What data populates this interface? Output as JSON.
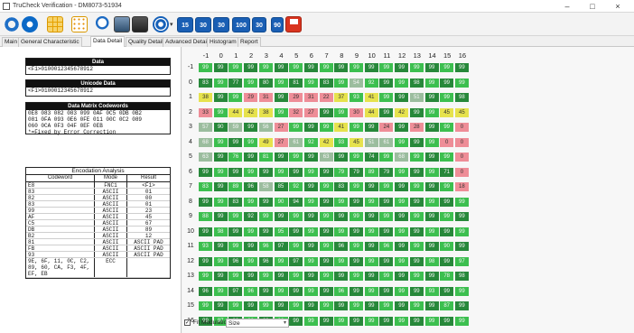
{
  "window": {
    "title": "TruCheck Verification - DM8073-51934"
  },
  "toolbar": {
    "buttons": [
      {
        "icon": "gear-refresh-icon"
      },
      {
        "icon": "refresh-icon"
      },
      {
        "icon": "module-grid-icon"
      },
      {
        "icon": "dotted-grid-icon"
      },
      {
        "icon": "zoom-icon"
      },
      {
        "icon": "image-icon"
      },
      {
        "icon": "image-dark-icon"
      },
      {
        "icon": "target-icon"
      }
    ],
    "level_buttons": [
      "15",
      "30",
      "30",
      "100",
      "30",
      "90"
    ]
  },
  "tabs": [
    "Main",
    "General Characteristic",
    "Data Detail",
    "Quality Detail",
    "Advanced Detail",
    "Histogram",
    "Report"
  ],
  "active_tab": "Data Detail",
  "data_panel": {
    "data": {
      "title": "Data",
      "value": "<F1>0100012345678912"
    },
    "unicode": {
      "title": "Unicode Data",
      "value": "<F1>0100012345678912"
    },
    "codewords": {
      "title": "Data Matrix Codewords",
      "lines": [
        "0E8 083 082 083 099 0AF 0C5 0DB 0B2",
        "081 0FA 093 0E6 0FE 011 00C 0C2 089",
        "060 0CA 0F3 04F 0EF 0EB",
        "*=Fixed by Error Correction"
      ]
    }
  },
  "encodation": {
    "title": "Encodation Analysis",
    "headers": [
      "Codeword",
      "Mode",
      "Result"
    ],
    "rows": [
      {
        "codeword": "E8",
        "mode": "FNC1",
        "result": "<F1>"
      },
      {
        "codeword": "83",
        "mode": "ASCII",
        "result": "01"
      },
      {
        "codeword": "82",
        "mode": "ASCII",
        "result": "00"
      },
      {
        "codeword": "83",
        "mode": "ASCII",
        "result": "01"
      },
      {
        "codeword": "99",
        "mode": "ASCII",
        "result": "23"
      },
      {
        "codeword": "AF",
        "mode": "ASCII",
        "result": "45"
      },
      {
        "codeword": "C5",
        "mode": "ASCII",
        "result": "67"
      },
      {
        "codeword": "DB",
        "mode": "ASCII",
        "result": "89"
      },
      {
        "codeword": "B2",
        "mode": "ASCII",
        "result": "12"
      },
      {
        "codeword": "81",
        "mode": "ASCII",
        "result": "ASCII PAD"
      },
      {
        "codeword": "FB",
        "mode": "ASCII",
        "result": "ASCII PAD"
      },
      {
        "codeword": "93",
        "mode": "ASCII",
        "result": "ASCII PAD"
      },
      {
        "codeword": "9E, 6F, 11, 0C, C2, 89, 60, CA, F3, 4F, EF, EB",
        "mode": "ECC",
        "result": ""
      }
    ]
  },
  "modulation_grid": {
    "columns": [
      "-1",
      "0",
      "1",
      "2",
      "3",
      "4",
      "5",
      "6",
      "7",
      "8",
      "9",
      "10",
      "11",
      "12",
      "13",
      "14",
      "15",
      "16"
    ],
    "rows": [
      "-1",
      "0",
      "1",
      "2",
      "3",
      "4",
      "5",
      "6",
      "7",
      "8",
      "9",
      "10",
      "11",
      "12",
      "13",
      "14",
      "15",
      "16"
    ],
    "values": [
      [
        "99",
        "99",
        "99",
        "99",
        "99",
        "99",
        "99",
        "99",
        "99",
        "99",
        "99",
        "99",
        "99",
        "99",
        "99",
        "99",
        "99",
        "99"
      ],
      [
        "83",
        "99",
        "77",
        "99",
        "80",
        "99",
        "81",
        "99",
        "83",
        "99",
        "54",
        "92",
        "99",
        "99",
        "98",
        "99",
        "99",
        "99"
      ],
      [
        "38",
        "99",
        "99",
        "29",
        "31",
        "99",
        "29",
        "31",
        "22",
        "37",
        "93",
        "41",
        "99",
        "99",
        "51",
        "99",
        "99",
        "98"
      ],
      [
        "33",
        "99",
        "44",
        "42",
        "38",
        "99",
        "32",
        "27",
        "99",
        "99",
        "30",
        "44",
        "99",
        "42",
        "99",
        "99",
        "45",
        "45"
      ],
      [
        "57",
        "90",
        "59",
        "99",
        "56",
        "27",
        "99",
        "99",
        "99",
        "41",
        "99",
        "99",
        "24",
        "99",
        "28",
        "99",
        "99",
        "0"
      ],
      [
        "68",
        "99",
        "99",
        "99",
        "49",
        "27",
        "61",
        "92",
        "42",
        "93",
        "45",
        "51",
        "61",
        "99",
        "99",
        "99",
        "0",
        "0"
      ],
      [
        "63",
        "99",
        "76",
        "99",
        "81",
        "99",
        "99",
        "99",
        "63",
        "99",
        "99",
        "74",
        "99",
        "68",
        "99",
        "99",
        "99",
        "0"
      ],
      [
        "99",
        "99",
        "99",
        "99",
        "99",
        "99",
        "99",
        "99",
        "99",
        "79",
        "79",
        "89",
        "79",
        "99",
        "99",
        "99",
        "71",
        "0"
      ],
      [
        "83",
        "99",
        "89",
        "96",
        "58",
        "85",
        "92",
        "99",
        "99",
        "83",
        "99",
        "99",
        "99",
        "99",
        "99",
        "99",
        "99",
        "18"
      ],
      [
        "99",
        "99",
        "83",
        "99",
        "99",
        "90",
        "94",
        "99",
        "99",
        "99",
        "99",
        "99",
        "99",
        "99",
        "99",
        "99",
        "99",
        "99"
      ],
      [
        "88",
        "99",
        "99",
        "92",
        "99",
        "99",
        "99",
        "99",
        "99",
        "99",
        "99",
        "99",
        "99",
        "99",
        "99",
        "99",
        "99",
        "99"
      ],
      [
        "99",
        "98",
        "99",
        "99",
        "99",
        "95",
        "99",
        "99",
        "99",
        "99",
        "99",
        "99",
        "99",
        "99",
        "99",
        "99",
        "99",
        "99"
      ],
      [
        "93",
        "99",
        "99",
        "99",
        "96",
        "97",
        "99",
        "99",
        "99",
        "96",
        "99",
        "99",
        "96",
        "99",
        "99",
        "99",
        "90",
        "99"
      ],
      [
        "99",
        "99",
        "96",
        "99",
        "96",
        "99",
        "97",
        "99",
        "99",
        "99",
        "99",
        "99",
        "99",
        "99",
        "99",
        "98",
        "99",
        "97"
      ],
      [
        "99",
        "99",
        "99",
        "99",
        "99",
        "99",
        "99",
        "99",
        "99",
        "99",
        "99",
        "99",
        "99",
        "99",
        "99",
        "99",
        "78",
        "98"
      ],
      [
        "96",
        "99",
        "97",
        "96",
        "99",
        "99",
        "99",
        "99",
        "99",
        "96",
        "99",
        "99",
        "99",
        "99",
        "99",
        "93",
        "99",
        "99"
      ],
      [
        "99",
        "99",
        "99",
        "99",
        "99",
        "99",
        "99",
        "99",
        "99",
        "99",
        "99",
        "99",
        "99",
        "99",
        "99",
        "99",
        "87",
        "99"
      ],
      [
        "99",
        "97",
        "99",
        "99",
        "99",
        "99",
        "99",
        "99",
        "99",
        "99",
        "99",
        "99",
        "99",
        "99",
        "99",
        "99",
        "99",
        "99"
      ]
    ],
    "colors": {
      "light": "#3cbf4f",
      "dark": "#27883a",
      "warning": "#e6e24d",
      "bad": "#ee8d97",
      "grey": "#9bbd9e"
    }
  },
  "fit_control": {
    "checkbox_label": "Fit Modulation Grid to",
    "checked": true,
    "check_mark": "✓",
    "select_value": "Size"
  }
}
